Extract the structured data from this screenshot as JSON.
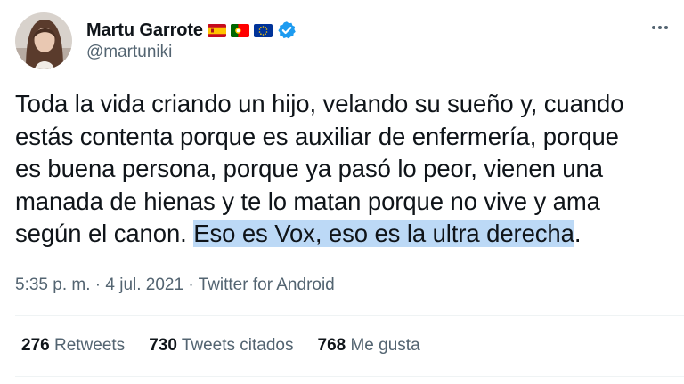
{
  "user": {
    "display_name": "Martu Garrote",
    "handle": "@martuniki",
    "flags": [
      "spain-flag-icon",
      "portugal-flag-icon",
      "eu-flag-icon"
    ],
    "verified_icon": "verified-badge-icon"
  },
  "tweet": {
    "lines": [
      "Toda la vida criando un hijo, velando su sueño y, cuando",
      "estás contenta porque es auxiliar de enfermería, porque",
      "es buena persona, porque ya pasó lo peor, vienen una",
      "manada de hienas y te lo matan porque no vive y ama"
    ],
    "last_line_plain": "según el canon. ",
    "last_line_highlight": "Eso es Vox, eso es la ultra derecha",
    "last_line_end": "."
  },
  "meta": {
    "time": "5:35 p. m.",
    "separator": " · ",
    "date": "4 jul. 2021",
    "source": "Twitter for Android"
  },
  "stats": {
    "retweets_count": "276",
    "retweets_label": "Retweets",
    "quotes_count": "730",
    "quotes_label": "Tweets citados",
    "likes_count": "768",
    "likes_label": "Me gusta"
  },
  "colors": {
    "text": "#0f1419",
    "secondary": "#536471",
    "verified": "#1d9bf0",
    "highlight": "#bcd9f6",
    "divider": "#eff3f4"
  }
}
